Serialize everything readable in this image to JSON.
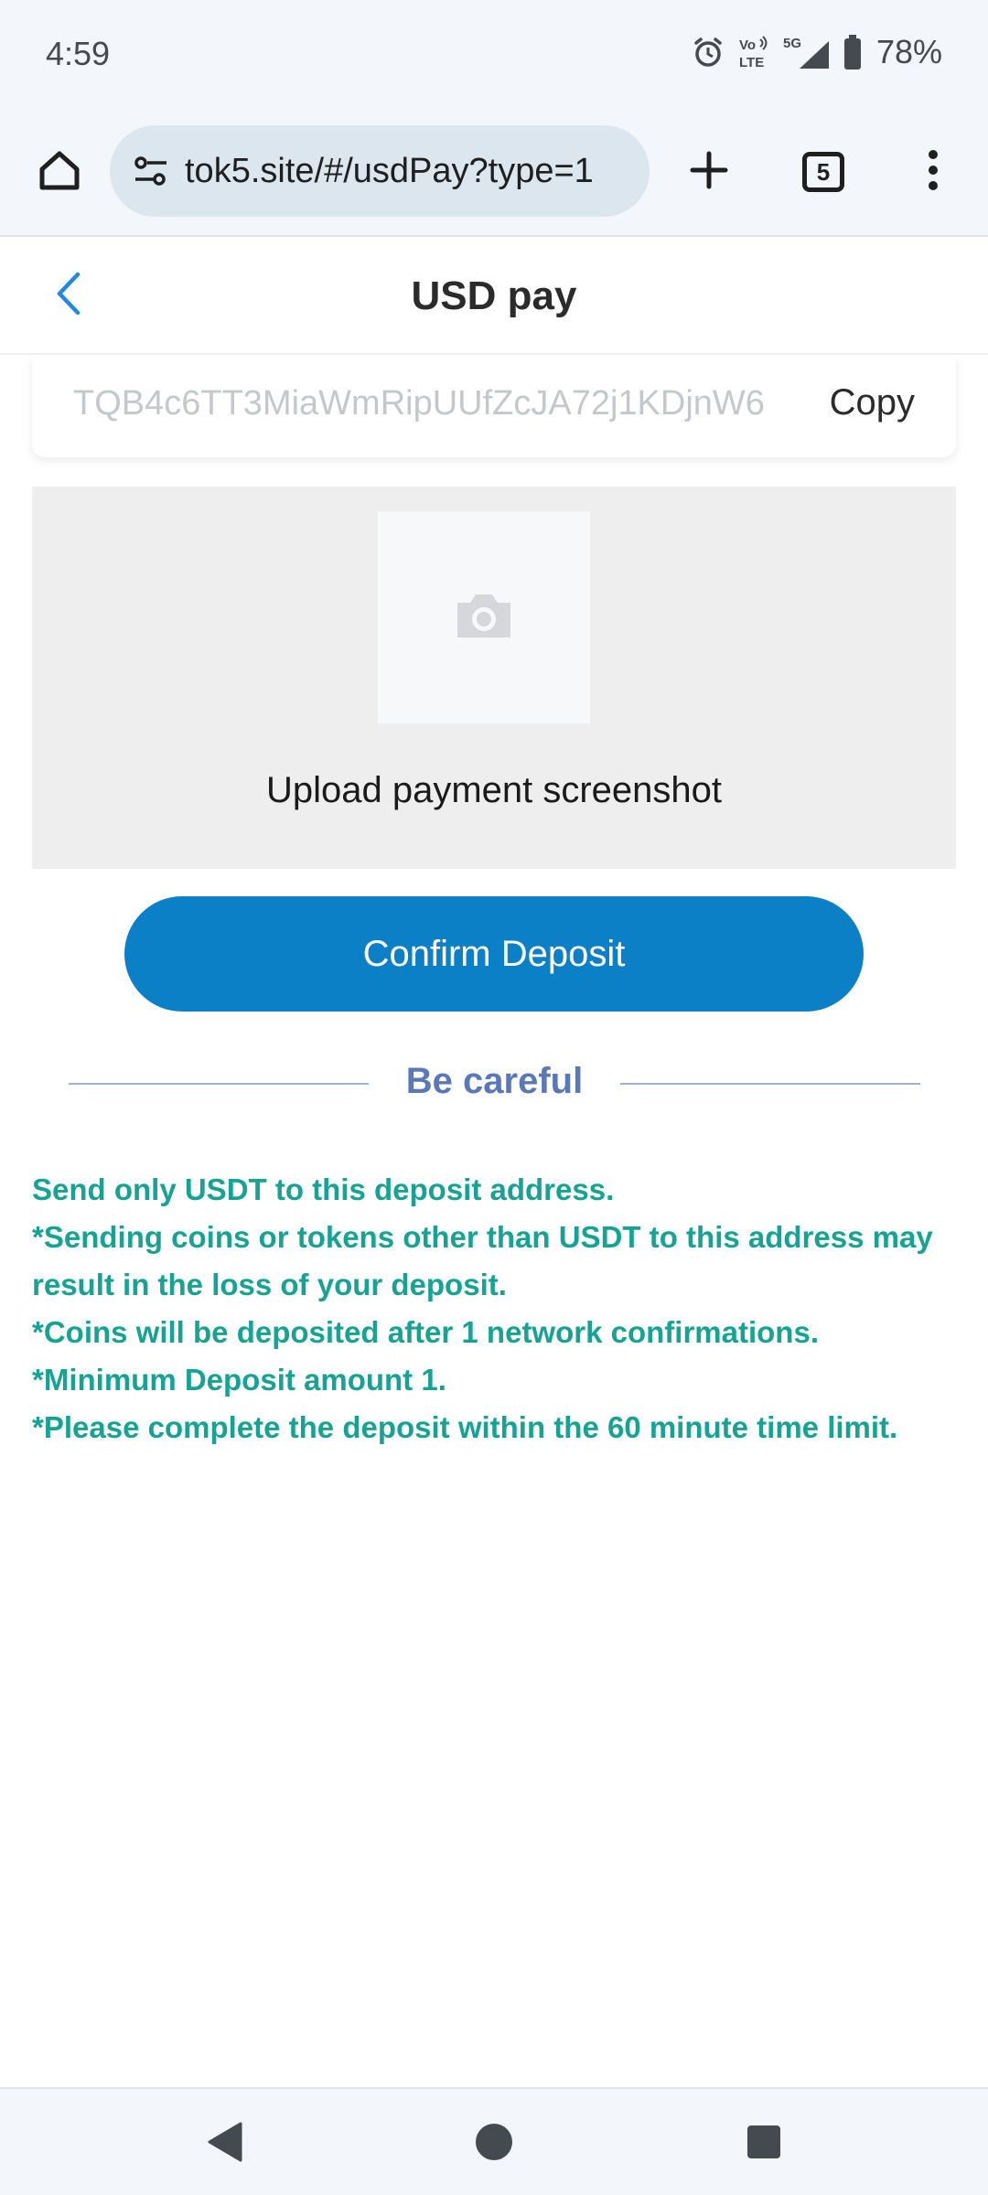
{
  "status_bar": {
    "time": "4:59",
    "network_top": "Vo",
    "network_bottom": "LTE",
    "signal_label": "5G",
    "battery": "78%",
    "icons": [
      "alarm-icon",
      "volte-icon",
      "signal-icon",
      "battery-icon"
    ]
  },
  "browser": {
    "url": "tok5.site/#/usdPay?type=1",
    "tab_count": "5",
    "icons": [
      "home-icon",
      "site-settings-icon",
      "new-tab-icon",
      "tabs-icon",
      "more-vert-icon"
    ]
  },
  "header": {
    "title": "USD pay",
    "back_icon": "chevron-left-icon"
  },
  "address": {
    "value": "TQB4c6TT3MiaWmRipUUfZcJA72j1KDjnW6",
    "copy_label": "Copy"
  },
  "upload": {
    "icon": "camera-icon",
    "label": "Upload payment screenshot"
  },
  "confirm_button": {
    "label": "Confirm Deposit"
  },
  "divider": {
    "label": "Be careful"
  },
  "notice": {
    "lines": [
      "Send only USDT to this deposit address.",
      "*Sending coins or tokens other than USDT to this address may result in the loss of your deposit.",
      "*Coins will be deposited after 1 network confirmations.",
      "*Minimum Deposit amount 1.",
      "*Please complete the deposit within the 60 minute time limit."
    ]
  },
  "colors": {
    "accent": "#0b80c6",
    "notice_text": "#17a393",
    "divider_text": "#5a78b8",
    "back_arrow": "#1e88e5"
  },
  "nav_bar": {
    "icons": [
      "nav-back-icon",
      "nav-home-icon",
      "nav-recents-icon"
    ]
  }
}
